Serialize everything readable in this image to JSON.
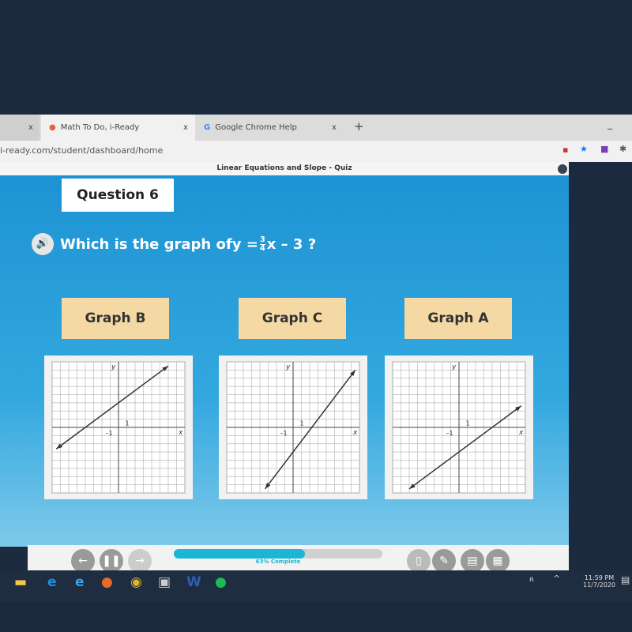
{
  "browser": {
    "tabs": [
      {
        "label": "",
        "close": "x"
      },
      {
        "label": "Math To Do, i-Ready",
        "close": "x"
      },
      {
        "label": "Google Chrome Help",
        "close": "x"
      }
    ],
    "new_tab": "+",
    "minimize": "–",
    "url": "i-ready.com/student/dashboard/home"
  },
  "quiz": {
    "title": "Linear Equations and Slope - Quiz",
    "question_label": "Question 6",
    "prompt_before": "Which is the graph of ",
    "equation_y": "y = ",
    "frac_num": "3",
    "frac_den": "4",
    "equation_rest": "x – 3 ?",
    "options": [
      {
        "label": "Graph B",
        "slope": 0.75,
        "intercept": 3
      },
      {
        "label": "Graph C",
        "slope": 1.333,
        "intercept": -3
      },
      {
        "label": "Graph A",
        "slope": 0.75,
        "intercept": -3
      }
    ],
    "axis": {
      "x": "x",
      "y": "y",
      "tick_pos": "1",
      "tick_neg": "–1",
      "range": [
        -8,
        8
      ]
    },
    "progress_percent": 63,
    "progress_label": "63% Complete"
  },
  "taskbar": {
    "time": "11:59 PM",
    "date": "11/7/2020"
  },
  "colors": {
    "content": "#1d93d3",
    "option": "#f4d9a4",
    "progress": "#1bb6d6"
  }
}
